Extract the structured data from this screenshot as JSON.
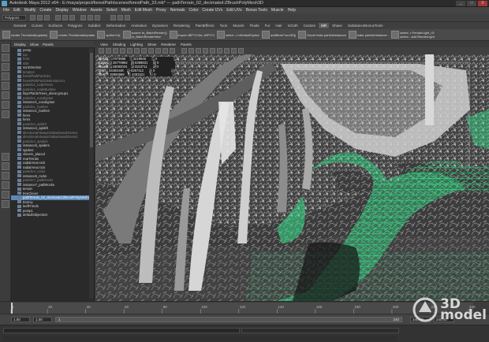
{
  "window": {
    "title": "Autodesk Maya 2012 x64 - E:/maya/project/forestPath/scenes/forestPath_23.mb* --- pathTerrain_02_decimated:ZBrushPolyMesh3D",
    "buttons": [
      "_",
      "□",
      "X"
    ]
  },
  "menubar": [
    "File",
    "Edit",
    "Modify",
    "Create",
    "Display",
    "Window",
    "Assets",
    "Select",
    "Mesh",
    "Edit Mesh",
    "Proxy",
    "Normals",
    "Color",
    "Create UVs",
    "Edit UVs",
    "Bonus Tools",
    "Muscle",
    "Help"
  ],
  "statusline": {
    "mode": "Polygons"
  },
  "shelf_tabs": {
    "items": [
      "General",
      "Curves",
      "Surfaces",
      "Polygons",
      "Subdivs",
      "Deformation",
      "Animation",
      "Dynamics",
      "Rendering",
      "PaintEffects",
      "Toon",
      "Muscle",
      "Fluids",
      "Fur",
      "Hair",
      "nCloth",
      "Custom",
      "MR",
      "Shave",
      "SubstanceBonusTools"
    ],
    "active": "MR"
  },
  "shelf": [
    {
      "label": "render Thumbnail(update)"
    },
    {
      "label": "render ThumbnailsUpdate"
    },
    {
      "label": "splAerCA("
    },
    {
      "label": "source br_BatchRender()\nbr_BatchRenderNew"
    },
    {
      "label": "import cBPYC/int, cBPYCi"
    },
    {
      "label": "select -r mDefaultOption"
    },
    {
      "label": "addBernFrom3D()"
    },
    {
      "label": "Depth  bake particleInstance"
    },
    {
      "label": "bake particleInstance -"
    },
    {
      "label": "select -r PenderLight_Ol\nselect - add RenderLight"
    }
  ],
  "outliner": {
    "menu": [
      "Display",
      "Show",
      "Panels"
    ],
    "items": [
      {
        "label": "persp",
        "dim": false
      },
      {
        "label": "top",
        "dim": true
      },
      {
        "label": "front",
        "dim": true
      },
      {
        "label": "side",
        "dim": true
      },
      {
        "label": "sunDirection",
        "dim": false
      },
      {
        "label": "tempty1",
        "dim": true
      },
      {
        "label": "forestPathParticle1",
        "dim": true
      },
      {
        "label": "forestPathParticlesInstance1",
        "dim": true
      },
      {
        "label": "particle1_nodeTrees",
        "dim": true
      },
      {
        "label": "particle1_nodeBushes",
        "dim": true
      },
      {
        "label": "lloycPlantsTrees_alone:group1",
        "dim": false
      },
      {
        "label": "particle1_eucalyptus",
        "dim": true
      },
      {
        "label": "instance1_eucalyptus",
        "dim": false
      },
      {
        "label": "particle1_bushes",
        "dim": true
      },
      {
        "label": "instance1_bushes",
        "dim": false
      },
      {
        "label": "ferns",
        "dim": false
      },
      {
        "label": "ferns",
        "dim": false
      },
      {
        "label": "particle4_aptdrtl",
        "dim": true
      },
      {
        "label": "instance4_aptdrtl",
        "dim": false
      },
      {
        "label": "directionalAlwaysOnBackwardSome1",
        "dim": true
      },
      {
        "label": "directionalAlwaysOnBackwardSome2",
        "dim": true
      },
      {
        "label": "particle4_spiders",
        "dim": true
      },
      {
        "label": "instance5_spiders",
        "dim": false
      },
      {
        "label": "spiders",
        "dim": false
      },
      {
        "label": "cloverv_placed",
        "dim": false
      },
      {
        "label": "rearTerrain",
        "dim": false
      },
      {
        "label": "radialArea:rock",
        "dim": false
      },
      {
        "label": "radialArea:rock",
        "dim": false
      },
      {
        "label": "particle4_rocks",
        "dim": true
      },
      {
        "label": "instance6_rocks",
        "dim": false
      },
      {
        "label": "particle7_pathRocks",
        "dim": true
      },
      {
        "label": "instance7_pathRocks",
        "dim": false
      },
      {
        "label": "terrain",
        "dim": false
      },
      {
        "label": "treeClover",
        "dim": false
      },
      {
        "label": "pathTerrain_02_decimated:ZBrushPolyMesh3D",
        "dim": false,
        "selected": true
      },
      {
        "label": "treeIvy",
        "dim": false
      },
      {
        "label": "leafFronds",
        "dim": false
      },
      {
        "label": "persp1",
        "dim": false
      },
      {
        "label": "defaultObjectSet",
        "dim": false
      }
    ]
  },
  "viewport": {
    "menu": [
      "View",
      "Shading",
      "Lighting",
      "Show",
      "Renderer",
      "Panels"
    ],
    "hud": [
      {
        "label": "Verts:",
        "v1": "17973868",
        "v2": "3219946",
        "v3": "0"
      },
      {
        "label": "Edges:",
        "v1": "35779962",
        "v2": "6369831",
        "v3": "0"
      },
      {
        "label": "Faces:",
        "v1": "18092034",
        "v2": "3153711",
        "v3": "0"
      },
      {
        "label": "Tris:",
        "v1": "34493448",
        "v2": "6257112",
        "v3": "0"
      },
      {
        "label": "UVs:",
        "v1": "29993868",
        "v2": "4381921",
        "v3": "0"
      }
    ]
  },
  "time": {
    "start": "1.00",
    "current": "1.00",
    "range_start": "1",
    "range_end": "240",
    "end": "240.00",
    "max": "240.00",
    "ticks": [
      "1",
      "20",
      "40",
      "60",
      "80",
      "100",
      "120",
      "140",
      "160",
      "180",
      "200",
      "220",
      "240"
    ]
  },
  "watermark": {
    "line1": "3D",
    "line2": "model"
  },
  "colors": {
    "selection": "#5c89b8",
    "wire_highlight": "#34e08a"
  }
}
